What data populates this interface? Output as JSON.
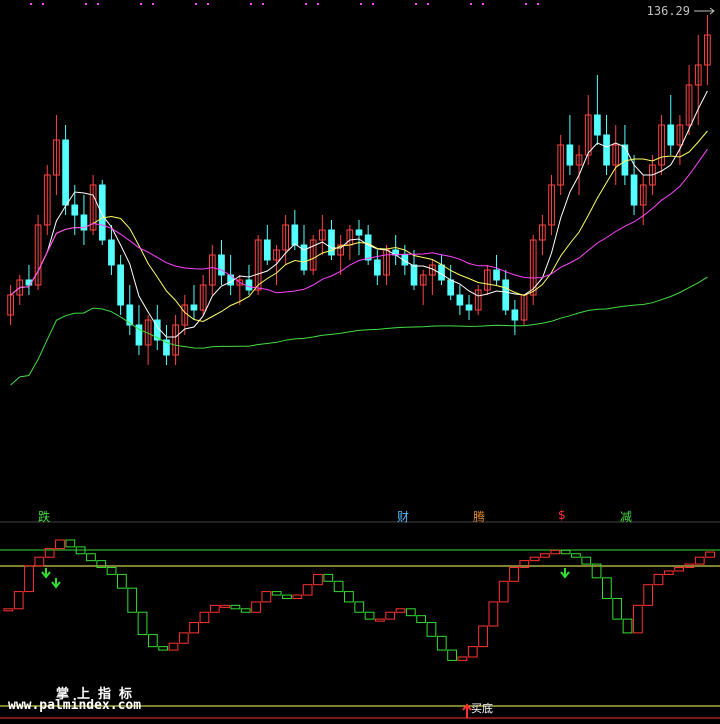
{
  "price_label": "136.29",
  "signals": [
    {
      "text": "跌",
      "color": "#44dd44"
    },
    {
      "text": "财",
      "color": "#55bbff"
    },
    {
      "text": "腾",
      "color": "#dd8833"
    },
    {
      "text": "$",
      "color": "#ff3333"
    },
    {
      "text": "减",
      "color": "#44dd44"
    }
  ],
  "watermark_cn": "掌上指标",
  "watermark_url": "www.palmindex.com",
  "buy_label": "买底",
  "colors": {
    "up": "#ff4444",
    "down": "#55ffff",
    "ma5": "#ffffff",
    "ma10": "#ffff66",
    "ma20": "#ff44ff",
    "ma60": "#44dd44",
    "osc_up": "#ff3333",
    "osc_down": "#33dd33"
  },
  "chart_data": {
    "type": "candlestick",
    "price_axis": {
      "min": 55,
      "max": 140
    },
    "candles": [
      [
        80,
        86,
        78,
        84
      ],
      [
        84,
        88,
        82,
        87
      ],
      [
        87,
        90,
        84,
        86
      ],
      [
        86,
        100,
        85,
        98
      ],
      [
        98,
        110,
        96,
        108
      ],
      [
        108,
        120,
        104,
        115
      ],
      [
        115,
        118,
        100,
        102
      ],
      [
        102,
        106,
        96,
        100
      ],
      [
        100,
        104,
        94,
        97
      ],
      [
        97,
        108,
        96,
        106
      ],
      [
        106,
        107,
        94,
        95
      ],
      [
        95,
        98,
        88,
        90
      ],
      [
        90,
        92,
        80,
        82
      ],
      [
        82,
        86,
        76,
        78
      ],
      [
        78,
        82,
        72,
        74
      ],
      [
        74,
        80,
        70,
        79
      ],
      [
        79,
        82,
        73,
        75
      ],
      [
        75,
        78,
        70,
        72
      ],
      [
        72,
        80,
        70,
        78
      ],
      [
        78,
        84,
        76,
        82
      ],
      [
        82,
        86,
        79,
        81
      ],
      [
        81,
        88,
        80,
        86
      ],
      [
        86,
        94,
        84,
        92
      ],
      [
        92,
        95,
        86,
        88
      ],
      [
        88,
        92,
        84,
        86
      ],
      [
        86,
        88,
        82,
        87
      ],
      [
        87,
        90,
        84,
        85
      ],
      [
        85,
        96,
        84,
        95
      ],
      [
        95,
        98,
        90,
        91
      ],
      [
        91,
        94,
        86,
        93
      ],
      [
        93,
        100,
        90,
        98
      ],
      [
        98,
        101,
        93,
        94
      ],
      [
        94,
        98,
        88,
        89
      ],
      [
        89,
        96,
        88,
        95
      ],
      [
        95,
        100,
        92,
        97
      ],
      [
        97,
        99,
        91,
        92
      ],
      [
        92,
        96,
        88,
        94
      ],
      [
        94,
        98,
        91,
        97
      ],
      [
        97,
        99,
        92,
        96
      ],
      [
        96,
        98,
        90,
        91
      ],
      [
        91,
        93,
        86,
        88
      ],
      [
        88,
        94,
        86,
        93
      ],
      [
        93,
        96,
        90,
        92
      ],
      [
        92,
        94,
        88,
        90
      ],
      [
        90,
        93,
        85,
        86
      ],
      [
        86,
        89,
        82,
        88
      ],
      [
        88,
        91,
        84,
        90
      ],
      [
        90,
        92,
        86,
        87
      ],
      [
        87,
        90,
        83,
        84
      ],
      [
        84,
        86,
        80,
        82
      ],
      [
        82,
        84,
        79,
        81
      ],
      [
        81,
        86,
        80,
        85
      ],
      [
        85,
        90,
        84,
        89
      ],
      [
        89,
        92,
        86,
        87
      ],
      [
        87,
        89,
        80,
        81
      ],
      [
        81,
        83,
        76,
        79
      ],
      [
        79,
        84,
        78,
        84
      ],
      [
        84,
        96,
        82,
        95
      ],
      [
        95,
        100,
        92,
        98
      ],
      [
        98,
        108,
        96,
        106
      ],
      [
        106,
        116,
        104,
        114
      ],
      [
        114,
        120,
        108,
        110
      ],
      [
        110,
        114,
        104,
        112
      ],
      [
        112,
        124,
        110,
        120
      ],
      [
        120,
        128,
        114,
        116
      ],
      [
        116,
        120,
        108,
        110
      ],
      [
        110,
        118,
        106,
        114
      ],
      [
        114,
        118,
        106,
        108
      ],
      [
        108,
        112,
        100,
        102
      ],
      [
        102,
        108,
        98,
        106
      ],
      [
        106,
        112,
        104,
        110
      ],
      [
        110,
        120,
        108,
        118
      ],
      [
        118,
        124,
        112,
        114
      ],
      [
        114,
        120,
        110,
        118
      ],
      [
        118,
        130,
        116,
        126
      ],
      [
        126,
        136,
        118,
        130
      ],
      [
        130,
        140,
        126,
        136
      ]
    ],
    "oscillator": [
      60,
      70,
      85,
      90,
      95,
      100,
      96,
      92,
      88,
      84,
      80,
      72,
      58,
      45,
      38,
      36,
      40,
      46,
      52,
      58,
      62,
      62,
      60,
      58,
      64,
      70,
      68,
      66,
      68,
      74,
      80,
      76,
      70,
      64,
      58,
      54,
      54,
      58,
      60,
      56,
      52,
      44,
      36,
      30,
      32,
      38,
      50,
      64,
      76,
      84,
      88,
      90,
      92,
      94,
      92,
      90,
      86,
      78,
      66,
      54,
      46,
      62,
      74,
      80,
      82,
      84,
      86,
      90,
      93
    ]
  }
}
